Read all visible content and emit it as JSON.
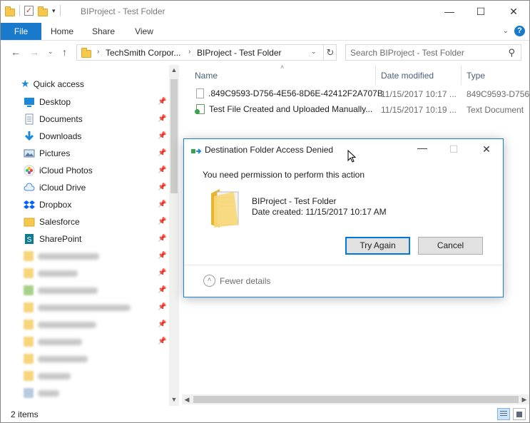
{
  "window": {
    "title": "BIProject - Test Folder",
    "controls": {
      "minimize": "—",
      "maximize": "☐",
      "close": "✕"
    }
  },
  "ribbon": {
    "tabs": [
      "File",
      "Home",
      "Share",
      "View"
    ]
  },
  "address": {
    "crumbs": [
      "TechSmith Corpor...",
      "BIProject - Test Folder"
    ],
    "search_placeholder": "Search BIProject - Test Folder"
  },
  "navpane": {
    "quick_access_label": "Quick access",
    "items": [
      {
        "label": "Desktop",
        "icon": "desktop-icon"
      },
      {
        "label": "Documents",
        "icon": "documents-icon"
      },
      {
        "label": "Downloads",
        "icon": "downloads-icon"
      },
      {
        "label": "Pictures",
        "icon": "pictures-icon"
      },
      {
        "label": "iCloud Photos",
        "icon": "icloud-photos-icon"
      },
      {
        "label": "iCloud Drive",
        "icon": "icloud-drive-icon"
      },
      {
        "label": "Dropbox",
        "icon": "dropbox-icon"
      },
      {
        "label": "Salesforce",
        "icon": "folder-icon"
      },
      {
        "label": "SharePoint",
        "icon": "sharepoint-icon"
      }
    ]
  },
  "content": {
    "columns": [
      "Name",
      "Date modified",
      "Type"
    ],
    "files": [
      {
        "name": ".849C9593-D756-4E56-8D6E-42412F2A707B",
        "date": "11/15/2017 10:17 ...",
        "type": "849C9593-D756-4..."
      },
      {
        "name": "Test File Created and Uploaded Manually...",
        "date": "11/15/2017 10:19 ...",
        "type": "Text Document"
      }
    ]
  },
  "status": {
    "count": "2 items"
  },
  "dialog": {
    "title": "Destination Folder Access Denied",
    "message": "You need permission to perform this action",
    "folder_name": "BIProject - Test Folder",
    "date_created": "Date created: 11/15/2017 10:17 AM",
    "try_again": "Try Again",
    "cancel": "Cancel",
    "fewer_details": "Fewer details"
  }
}
